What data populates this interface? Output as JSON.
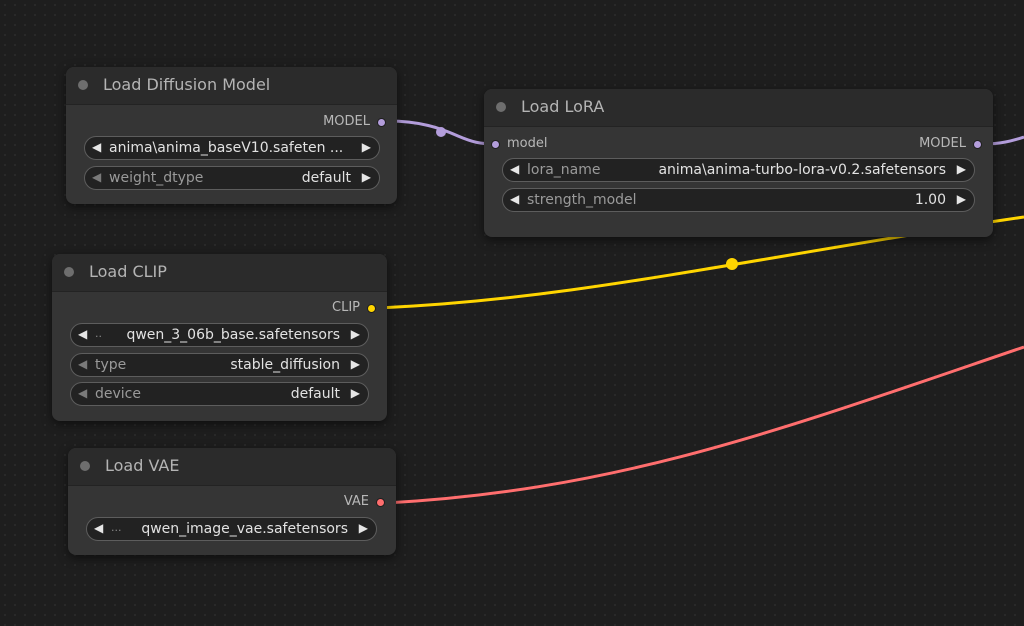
{
  "colors": {
    "model": "#b39ddb",
    "clip": "#ffd500",
    "vae": "#ff6e6e",
    "node_bg": "#353535",
    "canvas_bg": "#1e1e1e"
  },
  "nodes": {
    "load_diffusion_model": {
      "title": "Load Diffusion Model",
      "output_label": "MODEL",
      "widgets": {
        "unet_name": {
          "value": "anima\\anima_baseV10.safeten ..."
        },
        "weight_dtype": {
          "name": "weight_dtype",
          "value": "default"
        }
      }
    },
    "load_lora": {
      "title": "Load LoRA",
      "input_label": "model",
      "output_label": "MODEL",
      "widgets": {
        "lora_name": {
          "name": "lora_name",
          "value": "anima\\anima-turbo-lora-v0.2.safetensors"
        },
        "strength_model": {
          "name": "strength_model",
          "value": "1.00"
        }
      }
    },
    "load_clip": {
      "title": "Load CLIP",
      "output_label": "CLIP",
      "widgets": {
        "clip_name": {
          "prefix": "..",
          "value": "qwen_3_06b_base.safetensors"
        },
        "type": {
          "name": "type",
          "value": "stable_diffusion"
        },
        "device": {
          "name": "device",
          "value": "default"
        }
      }
    },
    "load_vae": {
      "title": "Load VAE",
      "output_label": "VAE",
      "widgets": {
        "vae_name": {
          "prefix": "...",
          "value": "qwen_image_vae.safetensors"
        }
      }
    }
  },
  "icons": {
    "arrow_left": "◀",
    "arrow_right": "▶"
  }
}
